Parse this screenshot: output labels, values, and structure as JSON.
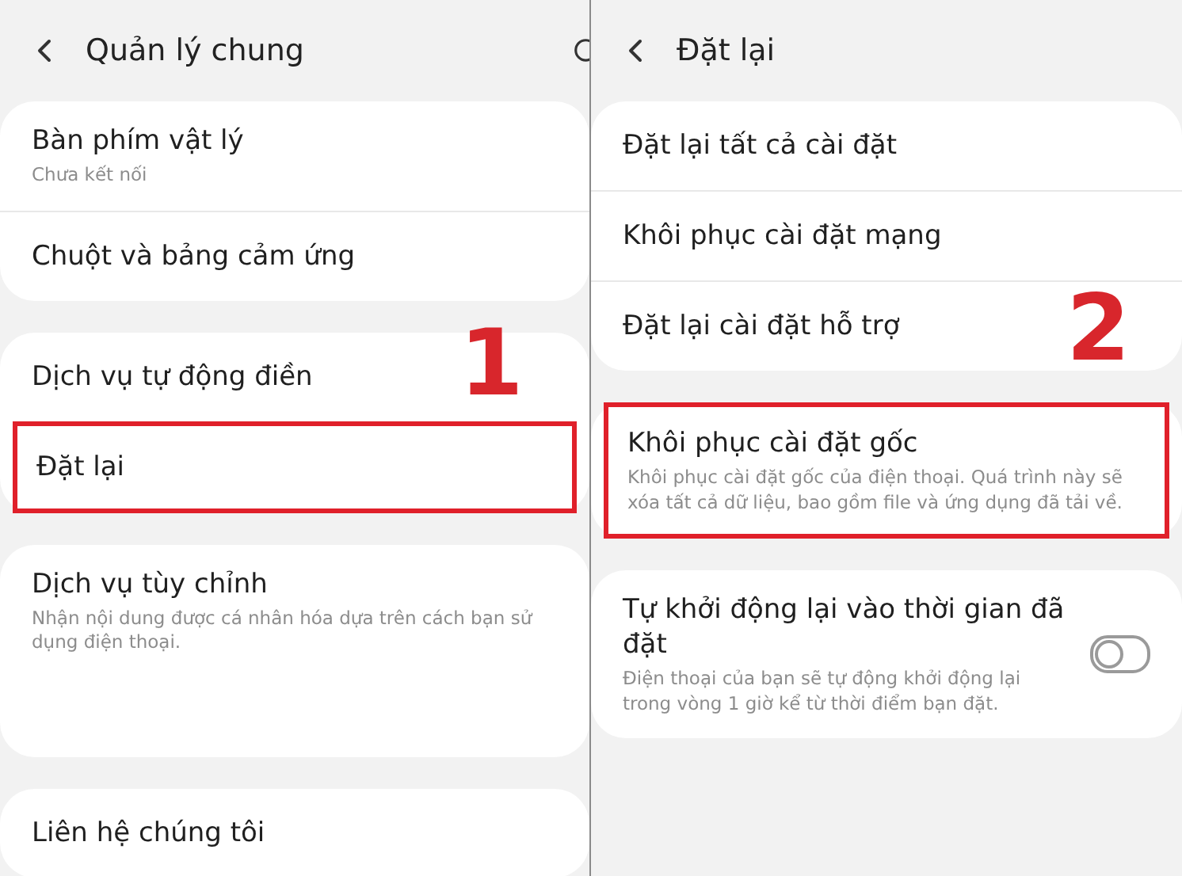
{
  "panels": [
    {
      "title": "Quản lý chung",
      "search": true,
      "step": "1",
      "groups": [
        {
          "items": [
            {
              "kind": "plain",
              "label": "Bàn phím vật lý",
              "subtitle": "Chưa kết nối",
              "highlighted": false
            },
            {
              "kind": "plain",
              "label": "Chuột và bảng cảm ứng",
              "highlighted": false
            }
          ]
        },
        {
          "items": [
            {
              "kind": "plain",
              "label": "Dịch vụ tự động điền",
              "highlighted": false
            },
            {
              "kind": "plain",
              "label": "Đặt lại",
              "highlighted": true
            }
          ]
        },
        {
          "items": [
            {
              "kind": "plain",
              "label": "Dịch vụ tùy chỉnh",
              "subtitle": "Nhận nội dung được cá nhân hóa dựa trên cách bạn sử dụng điện thoại.",
              "highlighted": false
            }
          ]
        },
        {
          "items": [
            {
              "kind": "plain",
              "label": "Liên hệ chúng tôi",
              "highlighted": false
            }
          ]
        }
      ]
    },
    {
      "title": "Đặt lại",
      "search": false,
      "step": "2",
      "groups": [
        {
          "items": [
            {
              "kind": "plain",
              "label": "Đặt lại tất cả cài đặt",
              "highlighted": false
            },
            {
              "kind": "plain",
              "label": "Khôi phục cài đặt mạng",
              "highlighted": false
            },
            {
              "kind": "plain",
              "label": "Đặt lại cài đặt hỗ trợ",
              "highlighted": false
            }
          ]
        },
        {
          "items": [
            {
              "kind": "plain",
              "label": "Khôi phục cài đặt gốc",
              "subtitle": "Khôi phục cài đặt gốc của điện thoại. Quá trình này sẽ xóa tất cả dữ liệu, bao gồm file và ứng dụng đã tải về.",
              "highlighted": true
            }
          ]
        },
        {
          "items": [
            {
              "kind": "toggle",
              "label": "Tự khởi động lại vào thời gian đã đặt",
              "subtitle": "Điện thoại của bạn sẽ tự động khởi động lại trong vòng 1 giờ kể từ thời điểm bạn đặt.",
              "highlighted": false,
              "on": false
            }
          ]
        }
      ]
    }
  ]
}
